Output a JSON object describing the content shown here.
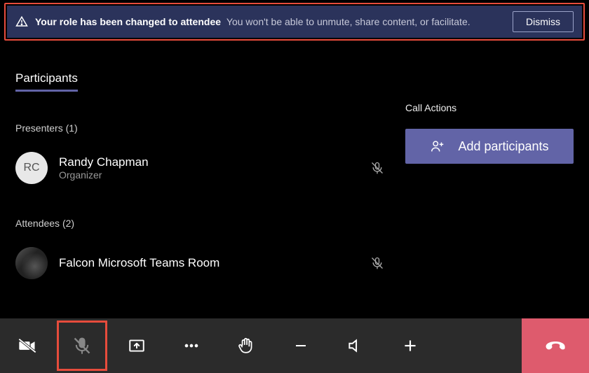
{
  "banner": {
    "strong": "Your role has been changed to attendee",
    "sub": "You won't be able to unmute, share content, or facilitate.",
    "dismiss": "Dismiss"
  },
  "tabs": {
    "participants": "Participants"
  },
  "presenters": {
    "label": "Presenters (1)",
    "items": [
      {
        "initials": "RC",
        "name": "Randy Chapman",
        "role": "Organizer"
      }
    ]
  },
  "attendees": {
    "label": "Attendees (2)",
    "items": [
      {
        "name": "Falcon Microsoft Teams Room"
      }
    ]
  },
  "callActions": {
    "label": "Call Actions",
    "add": "Add participants"
  }
}
